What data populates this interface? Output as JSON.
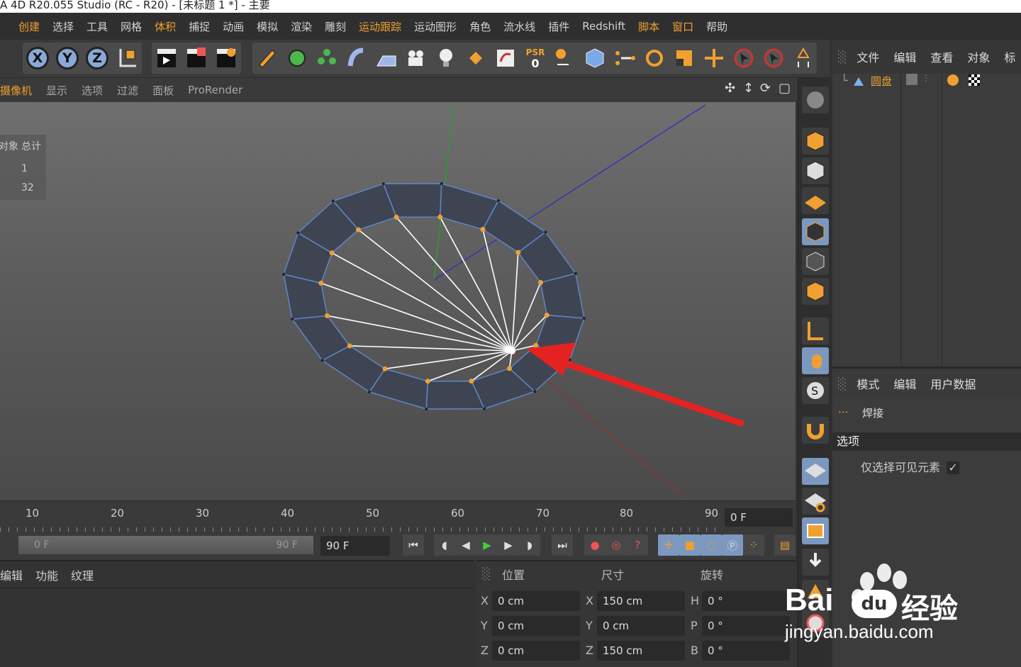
{
  "window": {
    "title": "A 4D R20.055 Studio (RC - R20) - [未标题 1 *] - 主要"
  },
  "menu": [
    "创建",
    "选择",
    "工具",
    "网格",
    "体积",
    "捕捉",
    "动画",
    "模拟",
    "渲染",
    "雕刻",
    "运动跟踪",
    "运动图形",
    "角色",
    "流水线",
    "插件",
    "Redshift",
    "脚本",
    "窗口",
    "帮助"
  ],
  "toolbar": {
    "axes": [
      "X",
      "Y",
      "Z"
    ],
    "psr_label": "PSR",
    "psr_value": "0"
  },
  "viewport_menu": [
    "摄像机",
    "显示",
    "选项",
    "过滤",
    "面板",
    "ProRender"
  ],
  "hud": {
    "col1": "对象",
    "col2": "总计",
    "row1": "1",
    "row2": "32"
  },
  "object_manager": {
    "menu": [
      "文件",
      "编辑",
      "查看",
      "对象",
      "标"
    ],
    "object_name": "圆盘"
  },
  "attribute_manager": {
    "menu": [
      "模式",
      "编辑",
      "用户数据"
    ],
    "tool_name": "焊接",
    "section": "选项",
    "option_label": "仅选择可见元素",
    "option_checked": "✓"
  },
  "timeline": {
    "ticks": [
      "10",
      "20",
      "30",
      "40",
      "50",
      "60",
      "70",
      "80",
      "90"
    ],
    "current_frame": "0 F",
    "range_start": "0 F",
    "range_end": "90 F",
    "end_frame": "90 F"
  },
  "material_manager": {
    "menu": [
      "编辑",
      "功能",
      "纹理"
    ]
  },
  "coordinates": {
    "headers": [
      "位置",
      "尺寸",
      "旋转"
    ],
    "position": [
      {
        "axis": "X",
        "value": "0 cm"
      },
      {
        "axis": "Y",
        "value": "0 cm"
      },
      {
        "axis": "Z",
        "value": "0 cm"
      }
    ],
    "size": [
      {
        "axis": "X",
        "value": "150 cm"
      },
      {
        "axis": "Y",
        "value": "0 cm"
      },
      {
        "axis": "Z",
        "value": "150 cm"
      }
    ],
    "rotation": [
      {
        "axis": "H",
        "value": "0 °"
      },
      {
        "axis": "P",
        "value": "0 °"
      },
      {
        "axis": "B",
        "value": "0 °"
      }
    ]
  },
  "watermark": {
    "brand": "Bai",
    "brand2": "经验",
    "url": "jingyan.baidu.com"
  },
  "colors": {
    "accent_orange": "#f0a030",
    "selection_white": "#ffffff",
    "annotation_red": "#e52222"
  }
}
